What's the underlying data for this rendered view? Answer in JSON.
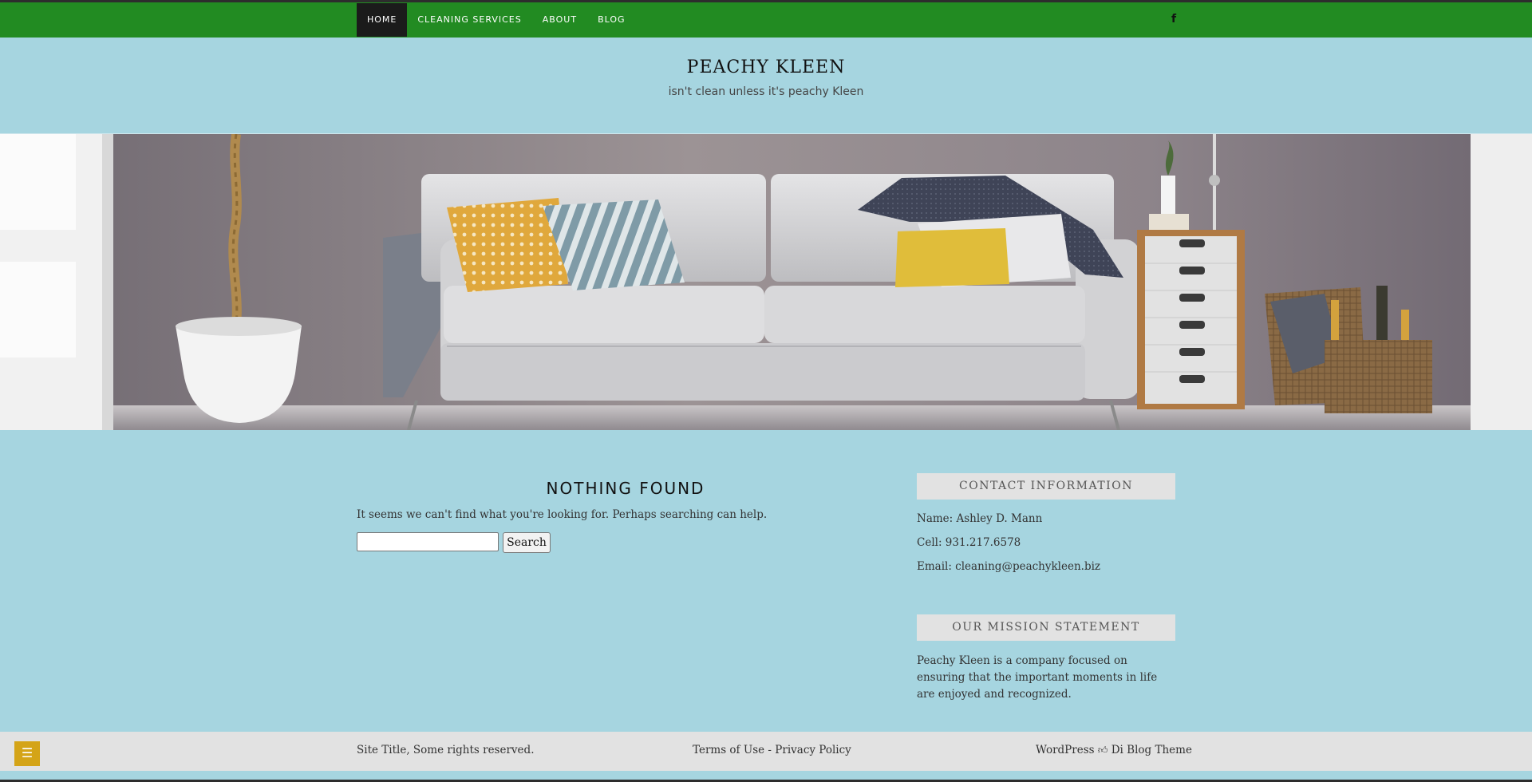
{
  "nav": {
    "items": [
      {
        "label": "HOME",
        "active": true
      },
      {
        "label": "CLEANING SERVICES",
        "active": false
      },
      {
        "label": "ABOUT",
        "active": false
      },
      {
        "label": "BLOG",
        "active": false
      }
    ],
    "social_icon": "facebook-icon",
    "social_glyph": "f",
    "bar_color": "#228b22"
  },
  "header": {
    "title": "PEACHY KLEEN",
    "tagline": "isn't clean unless it's peachy Kleen"
  },
  "hero": {
    "image": "living-room-sofa-photo"
  },
  "main": {
    "title": "NOTHING FOUND",
    "message": "It seems we can't find what you're looking for. Perhaps searching can help.",
    "search": {
      "value": "",
      "placeholder": "",
      "button_label": "Search"
    }
  },
  "sidebar": {
    "contact": {
      "title": "CONTACT INFORMATION",
      "name": "Name: Ashley D. Mann",
      "cell": "Cell: 931.217.6578",
      "email": "Email: cleaning@peachykleen.biz"
    },
    "mission": {
      "title": "OUR MISSION STATEMENT",
      "text": "Peachy Kleen is a company focused on ensuring that the important moments in life are enjoyed and recognized."
    }
  },
  "footer": {
    "menu_icon": "hamburger-icon",
    "copyright": "Site Title, Some rights reserved.",
    "terms": "Terms of Use",
    "separator": " - ",
    "privacy": "Privacy Policy",
    "credit_wordpress": "WordPress",
    "credit_theme": "Di Blog Theme",
    "accent": "#d4a418"
  }
}
